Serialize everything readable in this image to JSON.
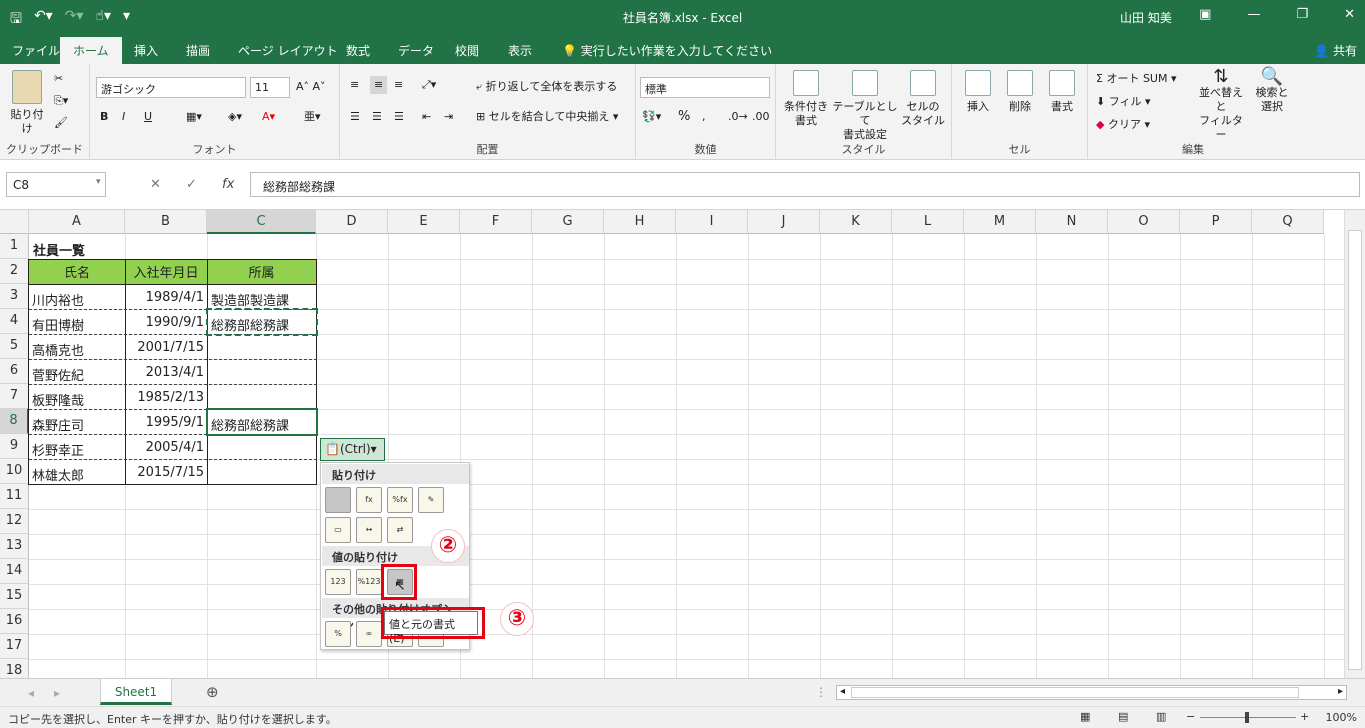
{
  "titlebar": {
    "title": "社員名簿.xlsx  -  Excel",
    "user": "山田 知美"
  },
  "tabs": [
    "ファイル",
    "ホーム",
    "挿入",
    "描画",
    "ページ レイアウト",
    "数式",
    "データ",
    "校閲",
    "表示"
  ],
  "tellme": "実行したい作業を入力してください",
  "share": "共有",
  "ribbon": {
    "clipboard": {
      "label": "クリップボード",
      "paste": "貼り付け"
    },
    "font": {
      "label": "フォント",
      "name": "游ゴシック",
      "size": "11",
      "bold": "B",
      "italic": "I",
      "underline": "U"
    },
    "alignment": {
      "label": "配置",
      "wrap": "折り返して全体を表示する",
      "merge": "セルを結合して中央揃え"
    },
    "number": {
      "label": "数値",
      "format": "標準",
      "percent": "%"
    },
    "styles": {
      "label": "スタイル",
      "cond": [
        "条件付き",
        "書式"
      ],
      "table": [
        "テーブルとして",
        "書式設定"
      ],
      "cellstyle": [
        "セルの",
        "スタイル"
      ]
    },
    "cells": {
      "label": "セル",
      "insert": "挿入",
      "delete": "削除",
      "format": "書式"
    },
    "editing": {
      "label": "編集",
      "autosum": "オート SUM",
      "fill": "フィル",
      "clear": "クリア",
      "sort": [
        "並べ替えと",
        "フィルター"
      ],
      "find": [
        "検索と",
        "選択"
      ]
    }
  },
  "formula_bar": {
    "namebox": "C8",
    "fx": "fx",
    "value": "総務部総務課"
  },
  "columns": [
    "A",
    "B",
    "C",
    "D",
    "E",
    "F",
    "G",
    "H",
    "I",
    "J",
    "K",
    "L",
    "M",
    "N",
    "O",
    "P",
    "Q"
  ],
  "rows": [
    "1",
    "2",
    "3",
    "4",
    "5",
    "6",
    "7",
    "8",
    "9",
    "10",
    "11",
    "12",
    "13",
    "14",
    "15",
    "16",
    "17",
    "18"
  ],
  "sheet": {
    "title": "社員一覧",
    "headers": [
      "氏名",
      "入社年月日",
      "所属"
    ],
    "data": [
      [
        "川内裕也",
        "1989/4/1",
        "製造部製造課"
      ],
      [
        "有田博樹",
        "1990/9/1",
        "総務部総務課"
      ],
      [
        "高橋克也",
        "2001/7/15",
        ""
      ],
      [
        "菅野佐紀",
        "2013/4/1",
        ""
      ],
      [
        "板野隆哉",
        "1985/2/13",
        ""
      ],
      [
        "森野庄司",
        "1995/9/1",
        "総務部総務課"
      ],
      [
        "杉野幸正",
        "2005/4/1",
        ""
      ],
      [
        "林雄太郎",
        "2015/7/15",
        ""
      ]
    ],
    "header_color": "#92d050"
  },
  "paste_popup": {
    "button": "(Ctrl)",
    "section1": "貼り付け",
    "section2": "値の貼り付け",
    "section3": "その他の貼り付けオプション",
    "tooltip": "値と元の書式 (E)",
    "badge2": "②",
    "badge3": "③"
  },
  "sheet_tab": "Sheet1",
  "statusbar": {
    "message": "コピー先を選択し、Enter キーを押すか、貼り付けを選択します。",
    "zoom": "100%"
  },
  "colors": {
    "accent": "#217346",
    "highlight": "#e50012"
  }
}
